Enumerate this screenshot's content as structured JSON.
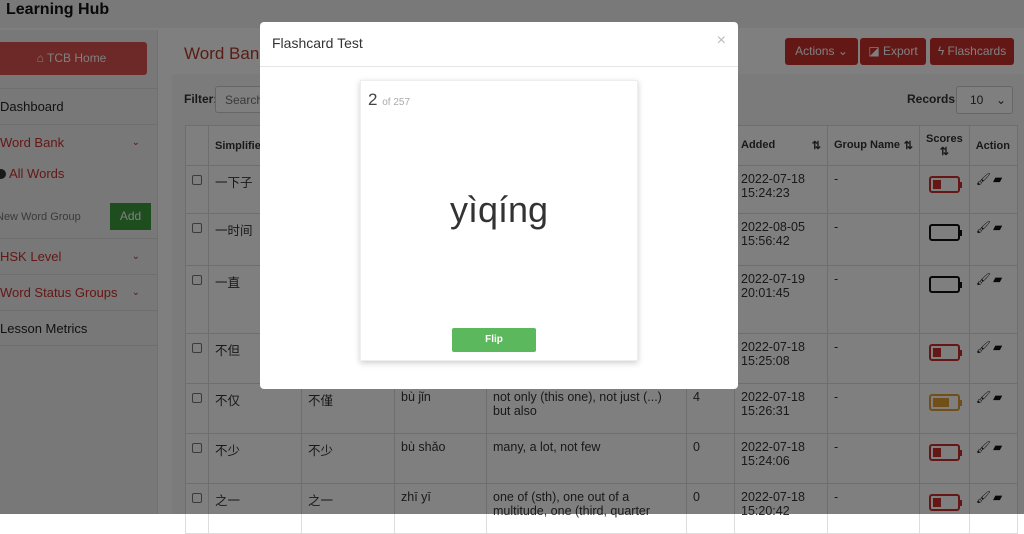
{
  "app": {
    "title": "Learning Hub"
  },
  "sidebar": {
    "home": "TCB Home",
    "dashboard": "Dashboard",
    "word_bank": "Word Bank",
    "all_words": "All Words",
    "word_group_placeholder": "New Word Group",
    "add": "Add",
    "hsk": "HSK Level",
    "status_groups": "Word Status Groups",
    "metrics": "Lesson Metrics"
  },
  "main": {
    "title": "Word Bank",
    "actions": "Actions",
    "export": "Export",
    "flashcards": "Flashcards",
    "filter_label": "Filter:",
    "search_placeholder": "Search",
    "records_label": "Records:",
    "records_value": "10"
  },
  "table": {
    "headers": {
      "simplified": "Simplified",
      "added": "Added",
      "group": "Group Name",
      "scores": "Scores",
      "action": "Action"
    },
    "rows": [
      {
        "simplified": "一下子",
        "traditional": "",
        "pinyin": "",
        "definition": "",
        "count": "",
        "added": "2022-07-18 15:24:23",
        "group": "-",
        "score_color": "#c9302c",
        "score_level": 0.3
      },
      {
        "simplified": "一时间",
        "traditional": "",
        "pinyin": "",
        "definition": "",
        "count": "",
        "added": "2022-08-05 15:56:42",
        "group": "-",
        "score_color": "#111111",
        "score_level": 0
      },
      {
        "simplified": "一直",
        "traditional": "",
        "pinyin": "",
        "definition": "",
        "count": "",
        "added": "2022-07-19 20:01:45",
        "group": "-",
        "score_color": "#111111",
        "score_level": 0
      },
      {
        "simplified": "不但",
        "traditional": "",
        "pinyin": "",
        "definition": "",
        "count": "",
        "added": "2022-07-18 15:25:08",
        "group": "-",
        "score_color": "#c9302c",
        "score_level": 0.3
      },
      {
        "simplified": "不仅",
        "traditional": "不僅",
        "pinyin": "bù jǐn",
        "definition": "not only (this one), not just (...) but also",
        "count": "4",
        "added": "2022-07-18 15:26:31",
        "group": "-",
        "score_color": "#e0a030",
        "score_level": 0.6
      },
      {
        "simplified": "不少",
        "traditional": "不少",
        "pinyin": "bù shǎo",
        "definition": "many, a lot, not few",
        "count": "0",
        "added": "2022-07-18 15:24:06",
        "group": "-",
        "score_color": "#c9302c",
        "score_level": 0.3
      },
      {
        "simplified": "之一",
        "traditional": "之一",
        "pinyin": "zhī yī",
        "definition": "one of (sth), one out of a multitude, one (third, quarter",
        "count": "0",
        "added": "2022-07-18 15:20:42",
        "group": "-",
        "score_color": "#c9302c",
        "score_level": 0.3
      }
    ]
  },
  "modal": {
    "title": "Flashcard Test",
    "close": "×",
    "current": "2",
    "of_total": "of 257",
    "word": "yìqíng",
    "flip": "Flip"
  }
}
